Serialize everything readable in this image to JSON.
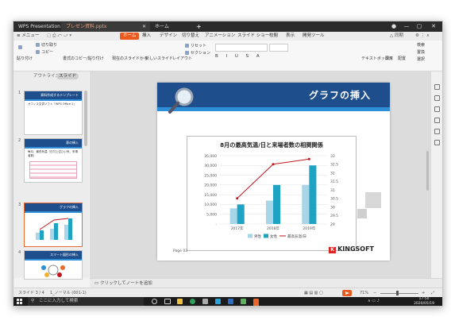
{
  "titlebar": {
    "home_tab": "WPS Presentation",
    "doc_tab": "プレゼン資料.pptx",
    "second_tab": "ホーム",
    "new_tab": "+"
  },
  "menubar": {
    "menu_label": "メニュー",
    "tabs": [
      "ホーム",
      "挿入",
      "デザイン",
      "切り替え",
      "アニメーション",
      "スライド ショー",
      "校閲",
      "表示",
      "開発ツール"
    ],
    "right": "△ 同期"
  },
  "ribbon": {
    "paste": "貼り付け",
    "cut": "切り取り",
    "copy": "コピー",
    "format_copy": "書式のコピー/貼り付け",
    "from_current": "現在のスライドから",
    "new_slide": "新しいスライド",
    "layout": "レイアウト",
    "reset": "リセット",
    "section": "セクション",
    "textbox": "テキストボックス",
    "shapes": "図形",
    "arrange": "配置",
    "find": "検索",
    "replace": "置換",
    "select": "選択"
  },
  "panel": {
    "outline_tab": "アウトライン",
    "slides_tab": "スライド",
    "thumbs": [
      {
        "num": "1",
        "title": "資料作成するテンプレート",
        "sub": "オフィス文書ソフト「WPS Office 2」"
      },
      {
        "num": "2",
        "title": "表の挿入",
        "sub": "毎月、最低気温（日付上空ひい気、来場者数）"
      },
      {
        "num": "3",
        "title": "グラフの挿入",
        "sub": ""
      },
      {
        "num": "4",
        "title": "スマート図形の挿入",
        "sub": ""
      }
    ]
  },
  "slide": {
    "title": "グラフの挿入",
    "footer": "Page 03",
    "logo": "KINGSOFT"
  },
  "chart_data": {
    "type": "bar",
    "title": "8月の最高気温/日と来場者数の相関関係",
    "categories": [
      "2017年",
      "2018年",
      "2019年"
    ],
    "series": [
      {
        "name": "男性",
        "values": [
          8000,
          12000,
          20000
        ],
        "color": "#a9d5e8"
      },
      {
        "name": "女性",
        "values": [
          10000,
          20000,
          30000
        ],
        "color": "#1ea3c3"
      },
      {
        "name": "最高気温/日",
        "values": [
          30.5,
          32.5,
          32.8
        ],
        "color": "#c0161e",
        "axis": "right",
        "kind": "line"
      }
    ],
    "ylim_left": [
      0,
      35000
    ],
    "ylim_right": [
      29,
      33
    ],
    "yticks_left": [
      "35,000",
      "30,000",
      "25,000",
      "20,000",
      "15,000",
      "10,000",
      "5,000",
      "-"
    ],
    "yticks_right": [
      "33",
      "32.5",
      "32",
      "31.5",
      "31",
      "30.5",
      "30",
      "29.5",
      "29"
    ],
    "grid": true,
    "legend": "bottom"
  },
  "notes": {
    "placeholder": "クリックしてノートを追加"
  },
  "status": {
    "slide_count": "スライド 3 / 4",
    "theme": "1_ノーマル (001-1)",
    "zoom": "71%"
  },
  "taskbar": {
    "search": "ここに入力して検索",
    "time": "17:50",
    "date": "2020/05/19"
  }
}
